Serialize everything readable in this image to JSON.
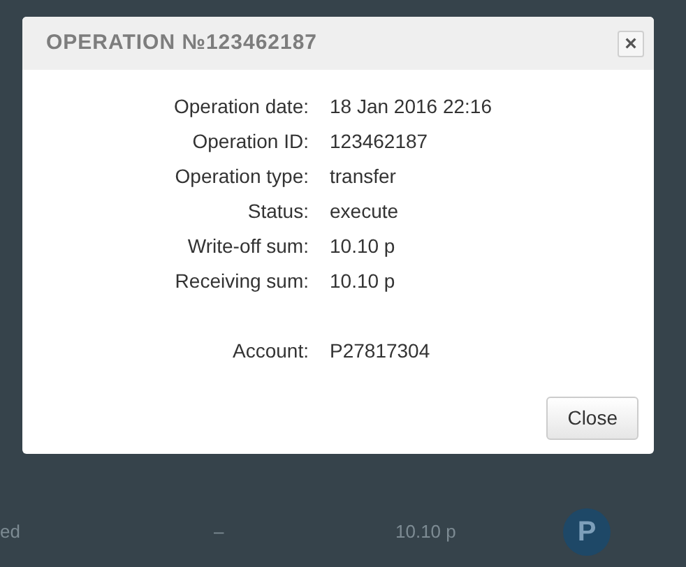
{
  "background_row": {
    "column_1": "ed",
    "column_2": "–",
    "column_3": "10.10 p",
    "badge": "P"
  },
  "dialog": {
    "title": "OPERATION №123462187",
    "close_glyph": "×",
    "fields": [
      {
        "label": "Operation date:",
        "value": "18 Jan 2016 22:16"
      },
      {
        "label": "Operation ID:",
        "value": "123462187"
      },
      {
        "label": "Operation type:",
        "value": "transfer"
      },
      {
        "label": "Status:",
        "value": "execute"
      },
      {
        "label": "Write-off sum:",
        "value": "10.10 p"
      },
      {
        "label": "Receiving sum:",
        "value": "10.10 p"
      }
    ],
    "account_fields": [
      {
        "label": "Account:",
        "value": "P27817304"
      }
    ],
    "buttons": [
      "Close"
    ]
  }
}
